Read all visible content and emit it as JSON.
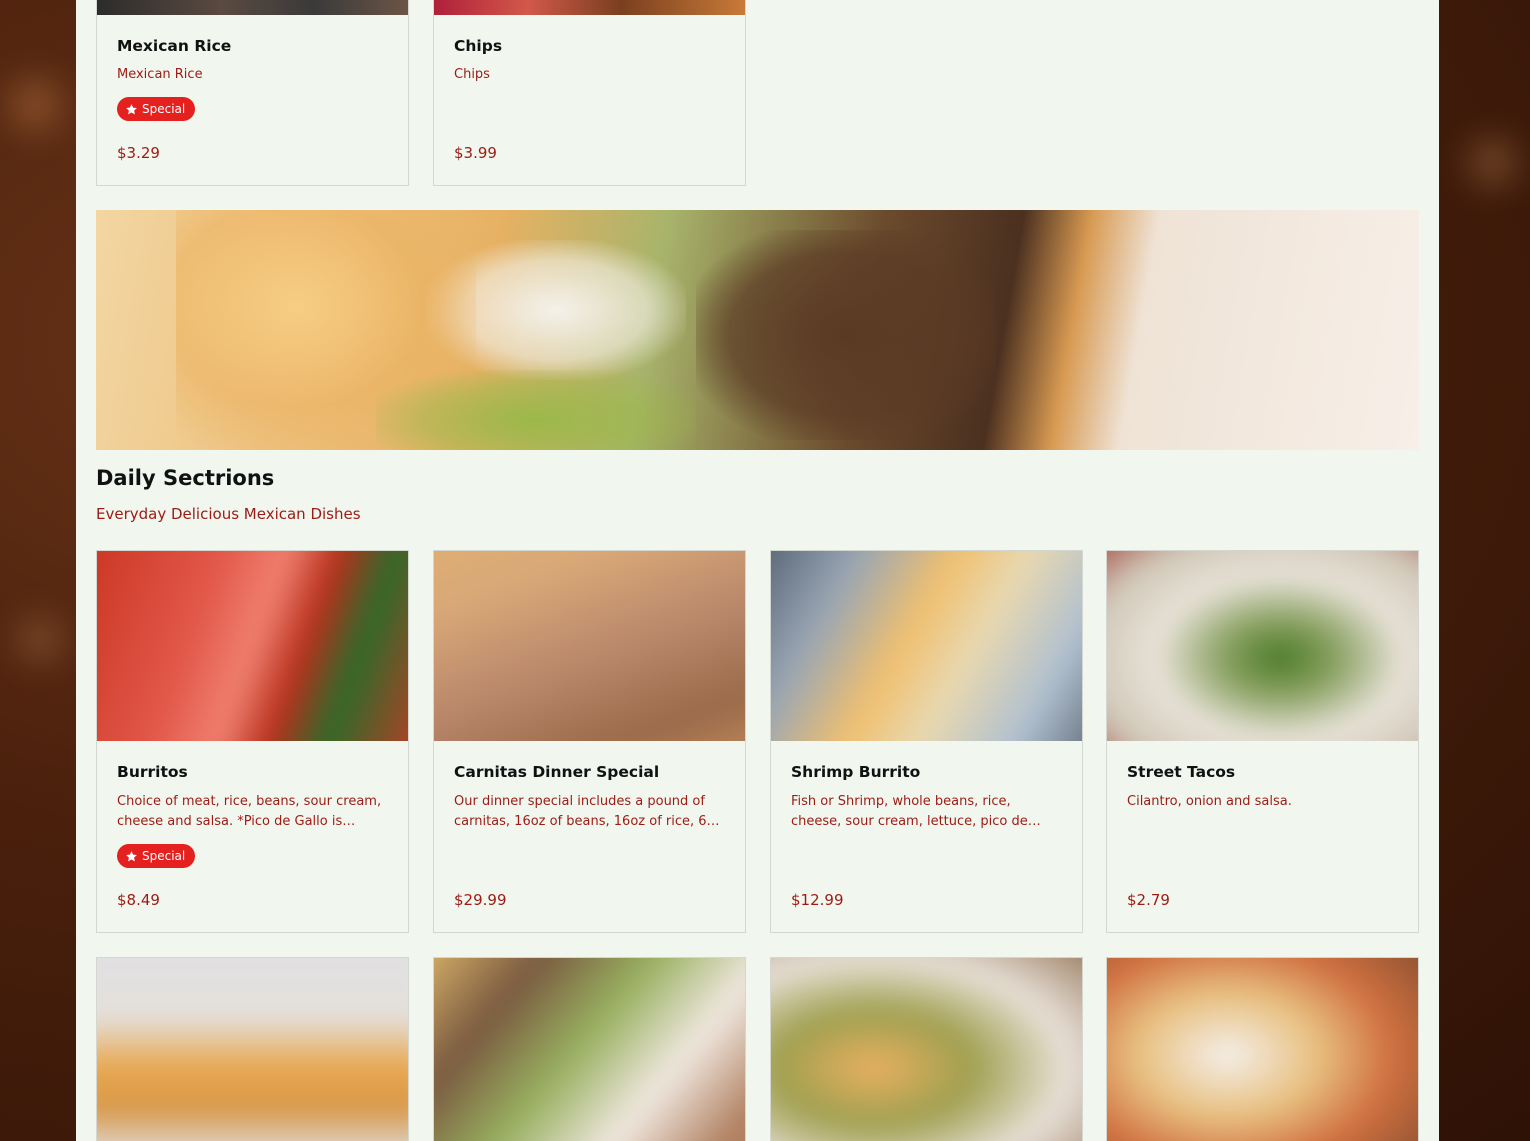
{
  "top_items": [
    {
      "title": "Mexican Rice",
      "description": "Mexican Rice",
      "badge": "Special",
      "price": "$3.29"
    },
    {
      "title": "Chips",
      "description": "Chips",
      "badge": "",
      "price": "$3.99"
    }
  ],
  "section": {
    "title": "Daily Sectrions",
    "subtitle": "Everyday Delicious Mexican Dishes"
  },
  "items": [
    {
      "title": "Burritos",
      "description": "Choice of meat, rice, beans, sour cream, cheese and salsa. *Pico de Gallo is…",
      "badge": "Special",
      "price": "$8.49"
    },
    {
      "title": "Carnitas Dinner Special",
      "description": "Our dinner special includes a pound of carnitas, 16oz of beans, 16oz of rice, 6…",
      "badge": "",
      "price": "$29.99"
    },
    {
      "title": "Shrimp Burrito",
      "description": "Fish or Shrimp, whole beans, rice, cheese, sour cream, lettuce, pico de gallo and…",
      "badge": "",
      "price": "$12.99"
    },
    {
      "title": "Street Tacos",
      "description": "Cilantro, onion and salsa.",
      "badge": "",
      "price": "$2.79"
    }
  ],
  "colors": {
    "accent_text": "#9b1c14",
    "badge_bg": "#e5211f",
    "page_bg": "#f1f6ef"
  },
  "icons": {
    "badge": "star-icon"
  }
}
